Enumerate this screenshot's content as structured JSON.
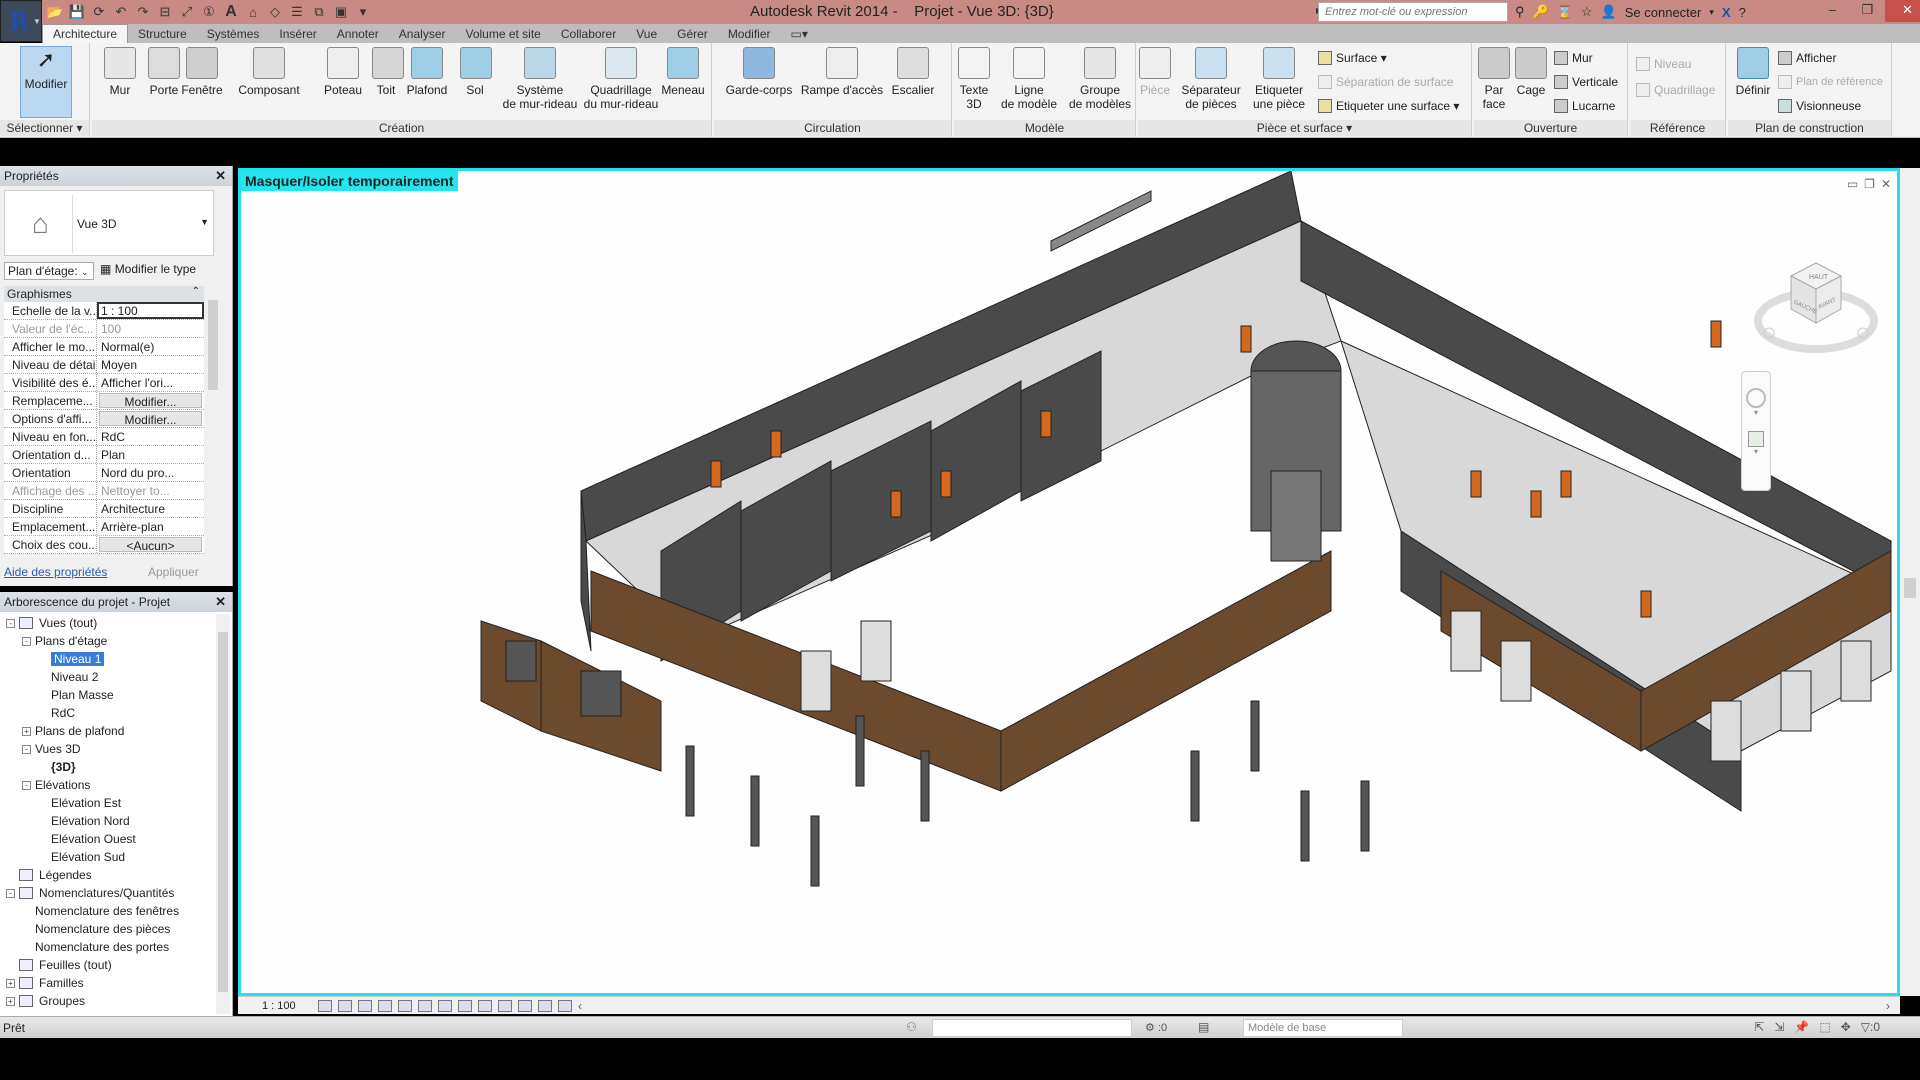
{
  "app": {
    "title": "Autodesk Revit 2014 -    Projet - Vue 3D: {3D}",
    "search_placeholder": "Entrez mot-clé ou expression",
    "sign_in": "Se connecter"
  },
  "tabs": [
    "Architecture",
    "Structure",
    "Systèmes",
    "Insérer",
    "Annoter",
    "Analyser",
    "Volume et site",
    "Collaborer",
    "Vue",
    "Gérer",
    "Modifier"
  ],
  "active_tab": "Architecture",
  "ribbon": {
    "select": {
      "modify": "Modifier",
      "title": "Sélectionner ▾"
    },
    "build": {
      "title": "Création",
      "buttons": [
        "Mur",
        "Porte",
        "Fenêtre",
        "Composant",
        "Poteau",
        "Toit",
        "Plafond",
        "Sol",
        "Système\nde mur-rideau",
        "Quadrillage\ndu mur-rideau",
        "Meneau"
      ]
    },
    "circulation": {
      "title": "Circulation",
      "buttons": [
        "Garde-corps",
        "Rampe d'accès",
        "Escalier"
      ]
    },
    "model": {
      "title": "Modèle",
      "buttons": [
        "Texte\n3D",
        "Ligne\nde modèle",
        "Groupe\nde modèles"
      ]
    },
    "room_area": {
      "title": "Pièce et surface ▾",
      "buttons": [
        "Pièce",
        "Séparateur\nde pièces",
        "Etiqueter\nune pièce"
      ],
      "small": [
        "Surface ▾",
        "Séparation de surface",
        "Etiqueter une surface ▾"
      ]
    },
    "opening": {
      "title": "Ouverture",
      "buttons": [
        "Par\nface",
        "Cage"
      ],
      "small": [
        "Mur",
        "Verticale",
        "Lucarne"
      ]
    },
    "datum": {
      "title": "Référence",
      "small": [
        "Niveau",
        "Quadrillage"
      ]
    },
    "workplane": {
      "title": "Plan de construction",
      "buttons": [
        "Définir"
      ],
      "small": [
        "Afficher",
        "Plan de référence",
        "Visionneuse"
      ]
    }
  },
  "properties": {
    "title": "Propriétés",
    "type_name": "Vue 3D",
    "instance_filter": "Plan d'étage:",
    "edit_type": "Modifier le type",
    "group": "Graphismes",
    "rows": [
      {
        "k": "Echelle de la v...",
        "v": "1 : 100"
      },
      {
        "k": "Valeur de l'éc...",
        "v": "100"
      },
      {
        "k": "Afficher le mo...",
        "v": "Normal(e)"
      },
      {
        "k": "Niveau de détail",
        "v": "Moyen"
      },
      {
        "k": "Visibilité des é...",
        "v": "Afficher l'ori..."
      },
      {
        "k": "Remplaceme...",
        "v": "Modifier..."
      },
      {
        "k": "Options d'affi...",
        "v": "Modifier..."
      },
      {
        "k": "Niveau en fon...",
        "v": "RdC"
      },
      {
        "k": "Orientation d...",
        "v": "Plan"
      },
      {
        "k": "Orientation",
        "v": "Nord du pro..."
      },
      {
        "k": "Affichage des ...",
        "v": "Nettoyer to..."
      },
      {
        "k": "Discipline",
        "v": "Architecture"
      },
      {
        "k": "Emplacement...",
        "v": "Arrière-plan"
      },
      {
        "k": "Choix des cou...",
        "v": "<Aucun>"
      }
    ],
    "help_link": "Aide des propriétés",
    "apply": "Appliquer"
  },
  "browser": {
    "title": "Arborescence du projet - Projet",
    "nodes": [
      {
        "label": "Vues (tout)",
        "level": 0,
        "exp": "-"
      },
      {
        "label": "Plans d'étage",
        "level": 1,
        "exp": "-"
      },
      {
        "label": "Niveau 1",
        "level": 2,
        "selected": true
      },
      {
        "label": "Niveau 2",
        "level": 2
      },
      {
        "label": "Plan Masse",
        "level": 2
      },
      {
        "label": "RdC",
        "level": 2
      },
      {
        "label": "Plans de plafond",
        "level": 1,
        "exp": "+"
      },
      {
        "label": "Vues 3D",
        "level": 1,
        "exp": "-"
      },
      {
        "label": "{3D}",
        "level": 2,
        "bold": true
      },
      {
        "label": "Elévations",
        "level": 1,
        "exp": "-"
      },
      {
        "label": "Elévation Est",
        "level": 2
      },
      {
        "label": "Elévation Nord",
        "level": 2
      },
      {
        "label": "Elévation Ouest",
        "level": 2
      },
      {
        "label": "Elévation Sud",
        "level": 2
      },
      {
        "label": "Légendes",
        "level": 0,
        "icon": true
      },
      {
        "label": "Nomenclatures/Quantités",
        "level": 0,
        "icon": true,
        "exp": "-"
      },
      {
        "label": "Nomenclature des fenêtres",
        "level": 1
      },
      {
        "label": "Nomenclature des pièces",
        "level": 1
      },
      {
        "label": "Nomenclature des portes",
        "level": 1
      },
      {
        "label": "Feuilles (tout)",
        "level": 0,
        "icon": true
      },
      {
        "label": "Familles",
        "level": 0,
        "icon": true,
        "exp": "+"
      },
      {
        "label": "Groupes",
        "level": 0,
        "icon": true,
        "exp": "+"
      }
    ]
  },
  "viewport": {
    "banner": "Masquer/Isoler temporairement",
    "viewcube": {
      "top": "HAUT",
      "left": "GAUCHE",
      "front": "AVANT"
    },
    "scale": "1 : 100",
    "colors": {
      "wall_dark": "#4a4a4a",
      "wall_light": "#d8d8d8",
      "brick": "#6b4a2e",
      "door": "#d2691e",
      "highlight": "#22e6f0"
    }
  },
  "status": {
    "text": "Prêt",
    "selection_count": ":0",
    "design_option": "Modèle de base",
    "filter_count": ":0"
  }
}
